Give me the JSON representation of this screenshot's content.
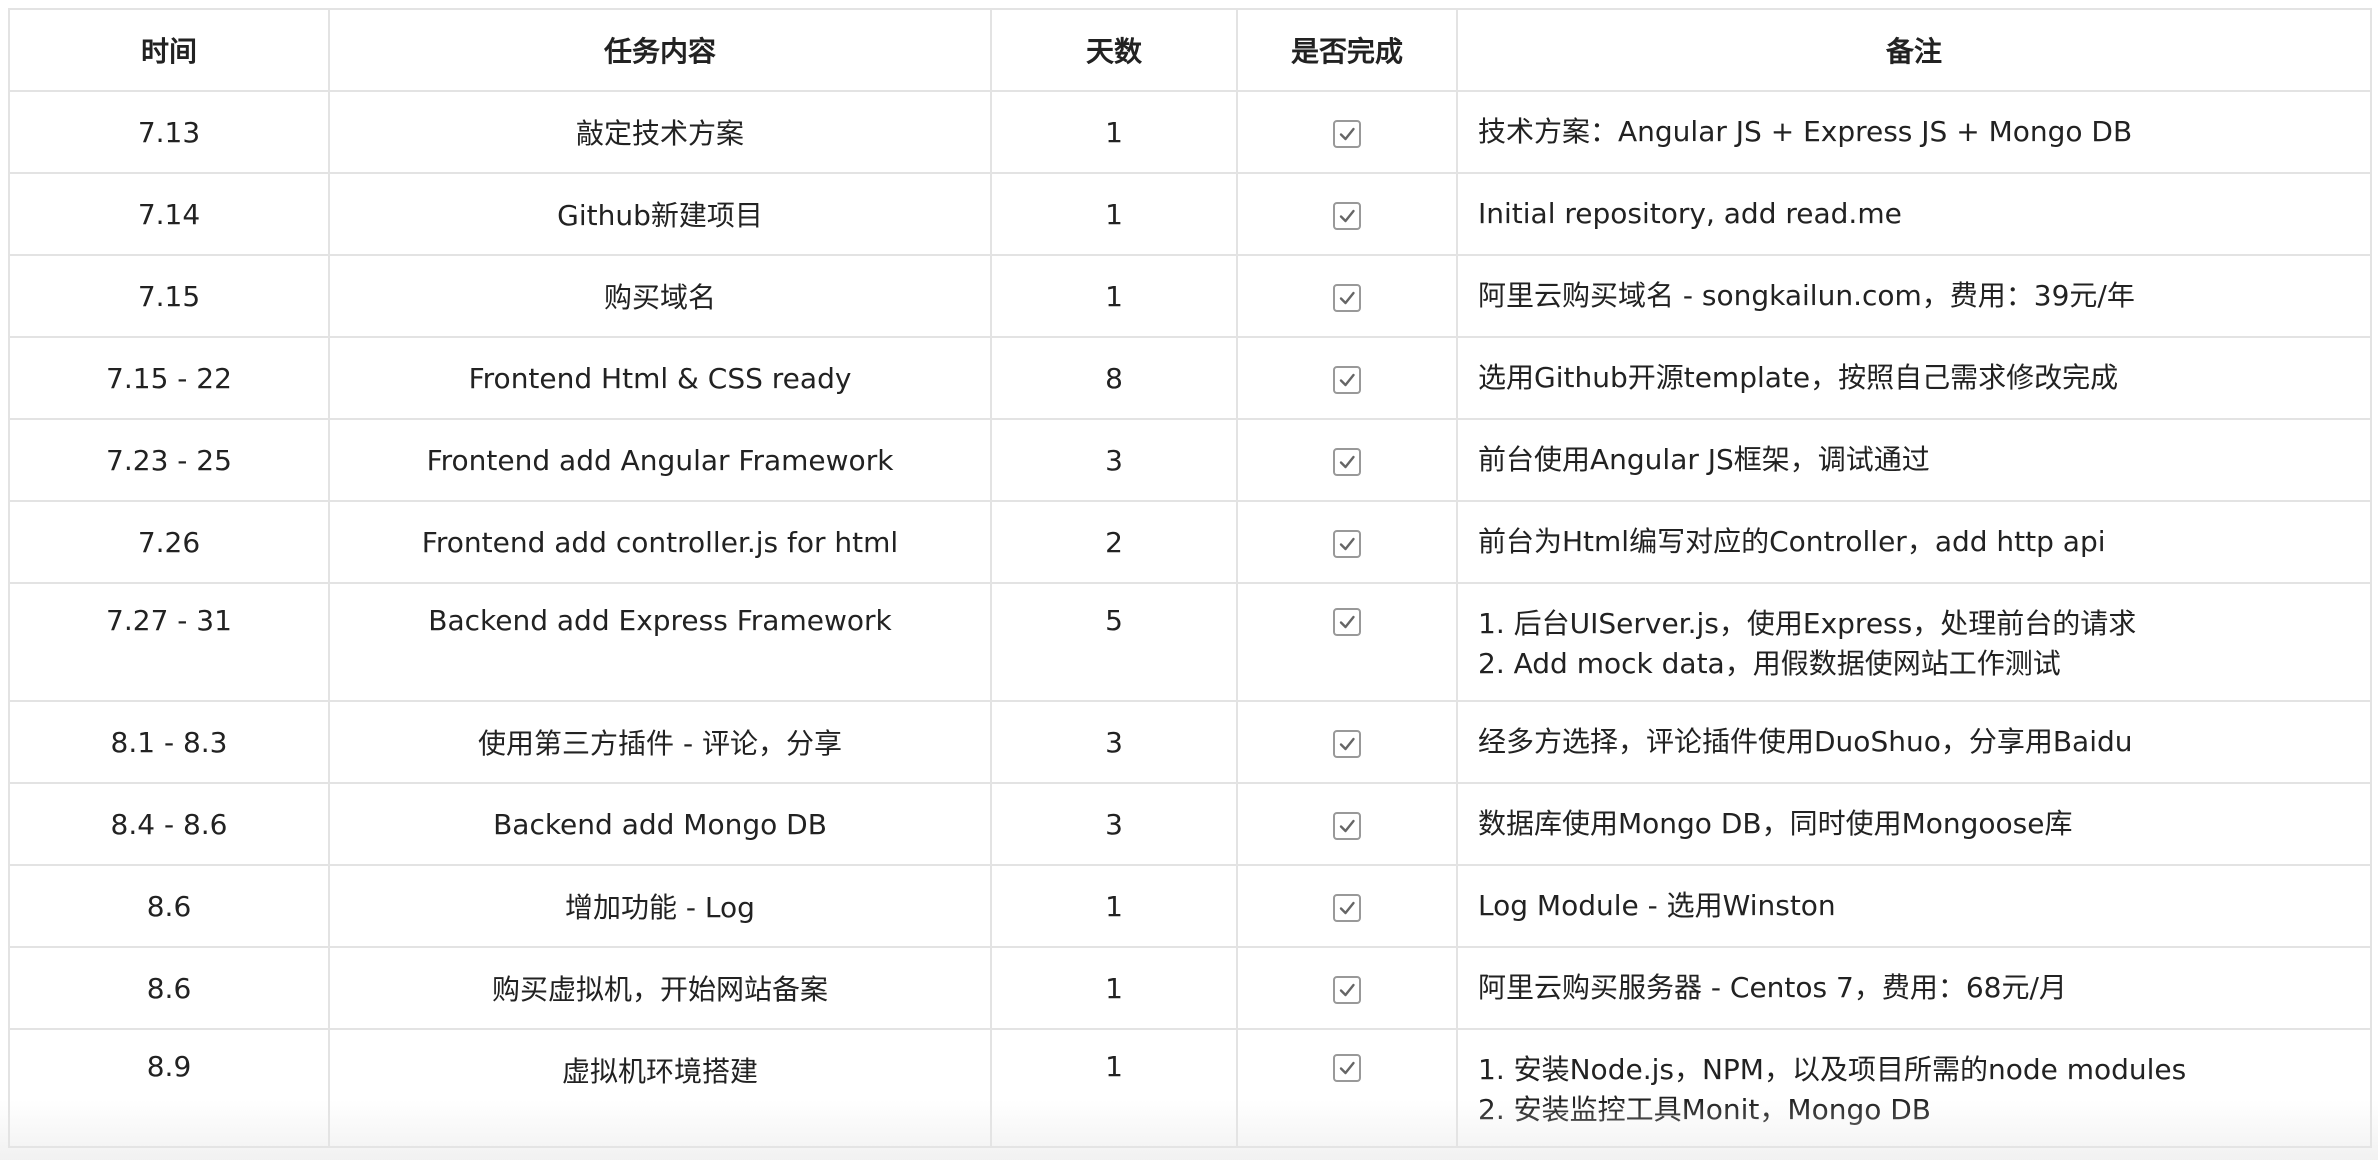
{
  "table": {
    "headers": [
      "时间",
      "任务内容",
      "天数",
      "是否完成",
      "备注"
    ],
    "rows": [
      {
        "time": "7.13",
        "task": "敲定技术方案",
        "days": "1",
        "done": true,
        "notes": [
          "技术方案：Angular JS + Express JS + Mongo DB"
        ]
      },
      {
        "time": "7.14",
        "task": "Github新建项目",
        "days": "1",
        "done": true,
        "notes": [
          "Initial repository, add read.me"
        ]
      },
      {
        "time": "7.15",
        "task": "购买域名",
        "days": "1",
        "done": true,
        "notes": [
          "阿里云购买域名 - songkailun.com，费用：39元/年"
        ]
      },
      {
        "time": "7.15 - 22",
        "task": "Frontend Html & CSS ready",
        "days": "8",
        "done": true,
        "notes": [
          "选用Github开源template，按照自己需求修改完成"
        ]
      },
      {
        "time": "7.23 -  25",
        "task": "Frontend add Angular Framework",
        "days": "3",
        "done": true,
        "notes": [
          "前台使用Angular JS框架，调试通过"
        ]
      },
      {
        "time": "7.26",
        "task": "Frontend add controller.js for html",
        "days": "2",
        "done": true,
        "notes": [
          "前台为Html编写对应的Controller，add http api"
        ]
      },
      {
        "time": "7.27 - 31",
        "task": "Backend add Express Framework",
        "days": "5",
        "done": true,
        "notes": [
          "1. 后台UIServer.js，使用Express，处理前台的请求",
          "2. Add mock data，用假数据使网站工作测试"
        ]
      },
      {
        "time": "8.1 - 8.3",
        "task": "使用第三方插件 - 评论，分享",
        "days": "3",
        "done": true,
        "notes": [
          "经多方选择，评论插件使用DuoShuo，分享用Baidu"
        ]
      },
      {
        "time": "8.4 - 8.6",
        "task": "Backend add Mongo DB",
        "days": "3",
        "done": true,
        "notes": [
          "数据库使用Mongo DB，同时使用Mongoose库"
        ]
      },
      {
        "time": "8.6",
        "task": "增加功能 - Log",
        "days": "1",
        "done": true,
        "notes": [
          "Log Module - 选用Winston"
        ]
      },
      {
        "time": "8.6",
        "task": "购买虚拟机，开始网站备案",
        "days": "1",
        "done": true,
        "notes": [
          "阿里云购买服务器 - Centos 7，费用：68元/月"
        ]
      },
      {
        "time": "8.9",
        "task": "虚拟机环境搭建",
        "days": "1",
        "done": true,
        "notes": [
          "1. 安装Node.js，NPM，以及项目所需的node modules",
          "2. 安装监控工具Monit，Mongo DB"
        ]
      }
    ]
  },
  "icons": {
    "checkbox": "checkbox-checked-icon"
  },
  "colors": {
    "border": "#e3e3e3",
    "checkbox_border": "#999999",
    "check_mark": "#666666",
    "text": "#222222"
  }
}
